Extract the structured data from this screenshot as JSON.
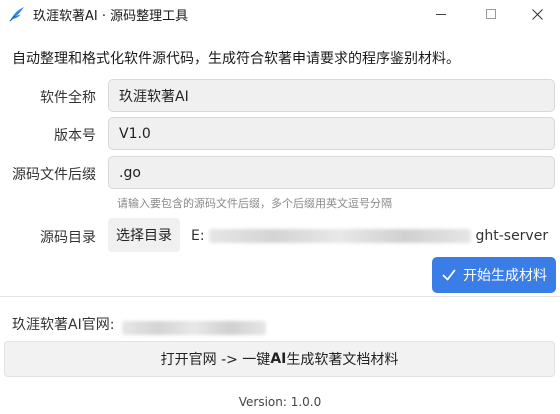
{
  "window": {
    "title": "玖涯软著AI · 源码整理工具",
    "controls": {
      "minimize": "minimize",
      "maximize": "maximize",
      "close": "close"
    }
  },
  "description": "自动整理和格式化软件源代码，生成符合软著申请要求的程序鉴别材料。",
  "form": {
    "software_name": {
      "label": "软件全称",
      "value": "玖涯软著AI"
    },
    "version": {
      "label": "版本号",
      "value": "V1.0"
    },
    "suffix": {
      "label": "源码文件后缀",
      "value": ".go",
      "hint": "请输入要包含的源码文件后缀，多个后缀用英文逗号分隔"
    },
    "source_dir": {
      "label": "源码目录",
      "button": "选择目录",
      "path_start": "E:",
      "path_end": "ght-server"
    }
  },
  "start_button": "开始生成材料",
  "site": {
    "label": "玖涯软著AI官网:"
  },
  "open_button": {
    "prefix": "打开官网 -> 一键",
    "bold": "AI",
    "suffix": "生成软著文档材料"
  },
  "version_text": "Version: 1.0.0",
  "colors": {
    "accent": "#3b7de6",
    "icon": "#2f87e8"
  },
  "icons": {
    "app": "feather-logo-icon",
    "check": "check-icon"
  }
}
